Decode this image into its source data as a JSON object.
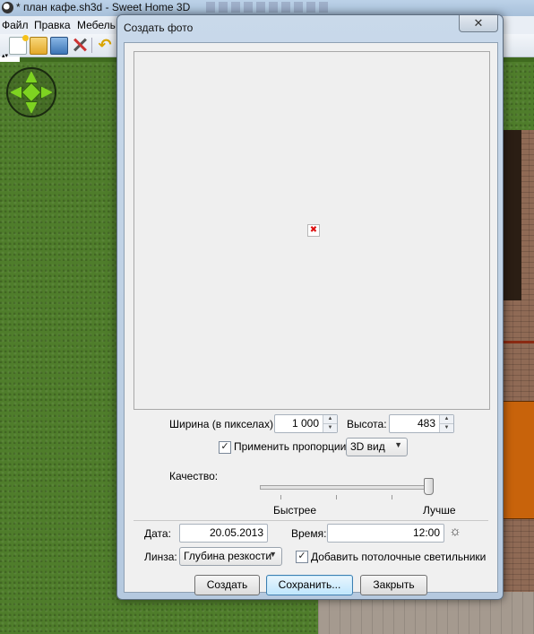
{
  "app": {
    "title": "* план кафе.sh3d - Sweet Home 3D",
    "menu": [
      "Файл",
      "Правка",
      "Мебель"
    ]
  },
  "dialog": {
    "title": "Создать фото",
    "close_label": "✕",
    "width_label": "Ширина (в пикселах):",
    "width_value": "1 000",
    "height_label": "Высота:",
    "height_value": "483",
    "proportions_label": "Применить пропорции:",
    "proportions_checked": true,
    "proportions_option": "3D вид",
    "quality_label": "Качество:",
    "quality_min_label": "Быстрее",
    "quality_max_label": "Лучше",
    "quality_level": 1.0,
    "date_label": "Дата:",
    "date_value": "20.05.2013",
    "time_label": "Время:",
    "time_value": "12:00",
    "lens_label": "Линза:",
    "lens_value": "Глубина резкости",
    "ceiling_lights_label": "Добавить потолочные светильники",
    "ceiling_lights_checked": true,
    "buttons": {
      "create": "Создать",
      "save": "Сохранить...",
      "close": "Закрыть"
    }
  },
  "icons": {
    "check": "✓",
    "spin_up": "▲",
    "spin_down": "▼",
    "combo_arrow": "▼",
    "sun": "☼",
    "broken_image": "✖"
  }
}
